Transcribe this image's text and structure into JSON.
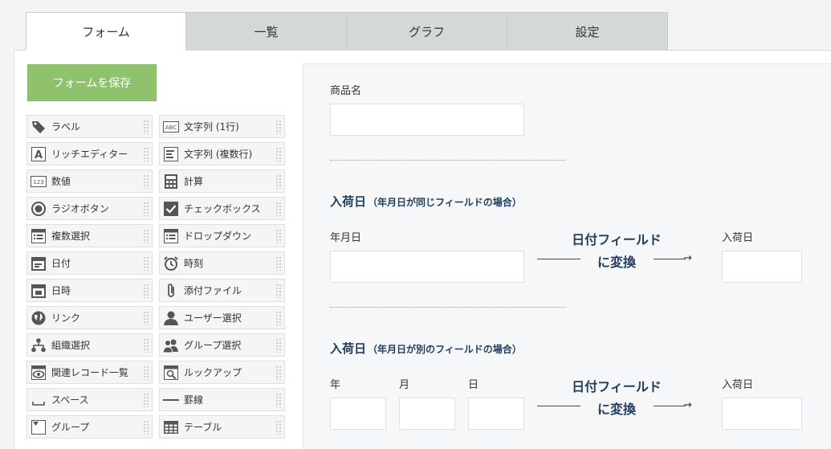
{
  "tabs": [
    "フォーム",
    "一覧",
    "グラフ",
    "設定"
  ],
  "save_button": "フォームを保存",
  "palette": [
    {
      "label": "ラベル",
      "icon": "tag-icon"
    },
    {
      "label": "文字列 (1行)",
      "icon": "abc-icon"
    },
    {
      "label": "リッチエディター",
      "icon": "rich-editor-icon"
    },
    {
      "label": "文字列 (複数行)",
      "icon": "multiline-text-icon"
    },
    {
      "label": "数値",
      "icon": "number-icon"
    },
    {
      "label": "計算",
      "icon": "calculator-icon"
    },
    {
      "label": "ラジオボタン",
      "icon": "radio-icon"
    },
    {
      "label": "チェックボックス",
      "icon": "checkbox-icon"
    },
    {
      "label": "複数選択",
      "icon": "multi-select-icon"
    },
    {
      "label": "ドロップダウン",
      "icon": "dropdown-icon"
    },
    {
      "label": "日付",
      "icon": "date-icon"
    },
    {
      "label": "時刻",
      "icon": "clock-icon"
    },
    {
      "label": "日時",
      "icon": "datetime-icon"
    },
    {
      "label": "添付ファイル",
      "icon": "paperclip-icon"
    },
    {
      "label": "リンク",
      "icon": "globe-icon"
    },
    {
      "label": "ユーザー選択",
      "icon": "user-icon"
    },
    {
      "label": "組織選択",
      "icon": "org-icon"
    },
    {
      "label": "グループ選択",
      "icon": "group-icon"
    },
    {
      "label": "関連レコード一覧",
      "icon": "related-records-icon"
    },
    {
      "label": "ルックアップ",
      "icon": "lookup-icon"
    },
    {
      "label": "スペース",
      "icon": "space-icon"
    },
    {
      "label": "罫線",
      "icon": "line-icon"
    },
    {
      "label": "グループ",
      "icon": "group-field-icon"
    },
    {
      "label": "テーブル",
      "icon": "table-icon"
    }
  ],
  "canvas": {
    "product_label": "商品名",
    "section1": {
      "title": "入荷日",
      "subtitle": "（年月日が同じフィールドの場合）",
      "ymd_label": "年月日",
      "conv_line1": "日付フィールド",
      "conv_line2": "に変換",
      "target_label": "入荷日"
    },
    "section2": {
      "title": "入荷日",
      "subtitle": "（年月日が別のフィールドの場合）",
      "year_label": "年",
      "month_label": "月",
      "day_label": "日",
      "conv_line1": "日付フィールド",
      "conv_line2": "に変換",
      "target_label": "入荷日"
    },
    "arrow": "→"
  }
}
